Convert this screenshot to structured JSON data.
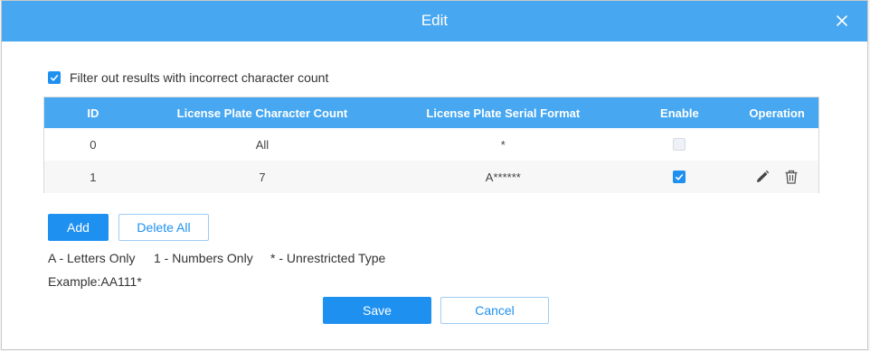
{
  "dialog": {
    "title": "Edit",
    "close_icon": "close-icon"
  },
  "filter": {
    "checked": true,
    "label": "Filter out results with incorrect character count"
  },
  "table": {
    "headers": {
      "id": "ID",
      "count": "License Plate Character Count",
      "format": "License Plate Serial Format",
      "enable": "Enable",
      "operation": "Operation"
    },
    "rows": [
      {
        "id": "0",
        "count": "All",
        "format": "*",
        "enabled": false,
        "enable_disabled": true,
        "has_operations": false
      },
      {
        "id": "1",
        "count": "7",
        "format": "A******",
        "enabled": true,
        "enable_disabled": false,
        "has_operations": true
      }
    ],
    "operation_icons": [
      "edit-icon",
      "delete-icon"
    ]
  },
  "actions": {
    "add_label": "Add",
    "delete_all_label": "Delete All"
  },
  "legend": {
    "letters": "A - Letters Only",
    "numbers": "1 - Numbers Only",
    "unrestricted": "* - Unrestricted Type",
    "example": "Example:AA111*"
  },
  "footer": {
    "save_label": "Save",
    "cancel_label": "Cancel"
  },
  "colors": {
    "header_blue": "#47a7f0",
    "primary": "#1e90f0"
  }
}
